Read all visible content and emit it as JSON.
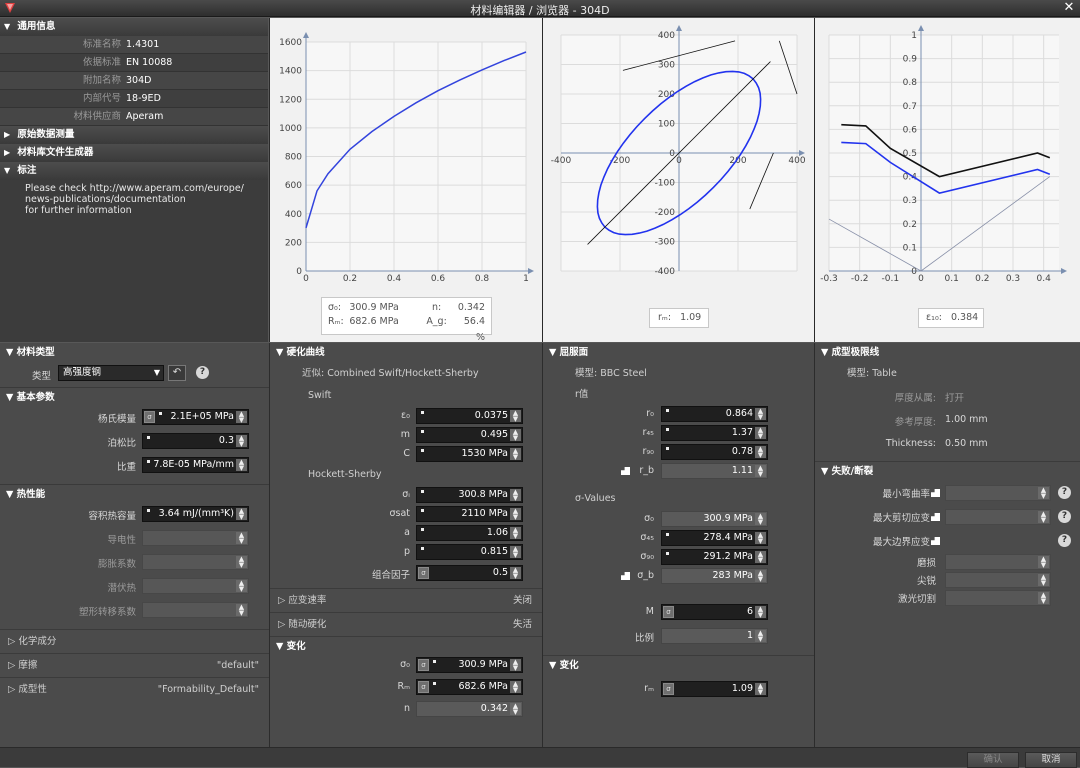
{
  "window": {
    "title": "材料编辑器 / 浏览器 - 304D",
    "close": "✕"
  },
  "general_info": {
    "header": "通用信息",
    "rows": [
      {
        "label": "标准名称",
        "value": "1.4301"
      },
      {
        "label": "依据标准",
        "value": "EN 10088"
      },
      {
        "label": "附加名称",
        "value": "304D"
      },
      {
        "label": "内部代号",
        "value": "18-9ED"
      },
      {
        "label": "材料供应商",
        "value": "Aperam"
      }
    ],
    "raw_data": "原始数据测量",
    "library_gen": "材料库文件生成器",
    "notes_header": "标注",
    "notes_lines": [
      "Please check http://www.aperam.com/europe/",
      "news-publications/documentation",
      "for further information"
    ]
  },
  "charts": {
    "hardening": {
      "x_ticks": [
        "0",
        "0.2",
        "0.4",
        "0.6",
        "0.8",
        "1"
      ],
      "y_ticks": [
        "0",
        "200",
        "400",
        "600",
        "800",
        "1000",
        "1200",
        "1400",
        "1600"
      ],
      "series_color": "#3344dd",
      "box": {
        "s0_label": "σ₀:",
        "s0": "300.9 MPa",
        "n_label": "n:",
        "n": "0.342",
        "rm_label": "Rₘ:",
        "rm": "682.6 MPa",
        "ag_label": "A_g:",
        "ag": "56.4 %"
      }
    },
    "yield": {
      "x_ticks": [
        "-400",
        "-200",
        "0",
        "200",
        "400"
      ],
      "y_ticks": [
        "-400",
        "-300",
        "-200",
        "-100",
        "0",
        "100",
        "200",
        "300",
        "400"
      ],
      "box": {
        "rm_label": "rₘ:",
        "rm": "1.09"
      }
    },
    "flc": {
      "x_ticks": [
        "-0.3",
        "-0.2",
        "-0.1",
        "0",
        "0.1",
        "0.2",
        "0.3",
        "0.4"
      ],
      "y_ticks": [
        "0",
        "0.1",
        "0.2",
        "0.3",
        "0.4",
        "0.5",
        "0.6",
        "0.7",
        "0.8",
        "0.9",
        "1"
      ],
      "box": {
        "e_label": "ε₁₀:",
        "e": "0.384"
      }
    }
  },
  "chart_data": [
    {
      "type": "line",
      "series": [
        {
          "values_x": [
            0,
            0.05,
            0.1,
            0.2,
            0.3,
            0.4,
            0.5,
            0.6,
            0.7,
            0.8,
            0.9,
            1.0
          ],
          "values_y": [
            301,
            560,
            680,
            850,
            975,
            1080,
            1175,
            1260,
            1335,
            1405,
            1470,
            1530
          ]
        }
      ],
      "xlim": [
        0,
        1
      ],
      "ylim": [
        0,
        1600
      ]
    },
    {
      "type": "line",
      "xlim": [
        -400,
        400
      ],
      "ylim": [
        -400,
        400
      ]
    },
    {
      "type": "line",
      "series": [
        {
          "x": [
            -0.26,
            -0.18,
            -0.1,
            0.06,
            0.38,
            0.42
          ],
          "y": [
            0.62,
            0.615,
            0.52,
            0.4,
            0.5,
            0.48
          ]
        },
        {
          "x": [
            -0.26,
            -0.18,
            -0.1,
            0.06,
            0.38,
            0.42
          ],
          "y": [
            0.545,
            0.54,
            0.46,
            0.33,
            0.43,
            0.41
          ]
        }
      ],
      "xlim": [
        -0.3,
        0.4
      ],
      "ylim": [
        0,
        1
      ]
    }
  ],
  "material_type": {
    "header": "材料类型",
    "type_label": "类型",
    "type_value": "高强度钢"
  },
  "basic_params": {
    "header": "基本参数",
    "rows": [
      {
        "label": "杨氏模量",
        "value": "2.1E+05 MPa"
      },
      {
        "label": "泊松比",
        "value": "0.3"
      },
      {
        "label": "比重",
        "value": "7.8E-05 MPa/mm"
      }
    ]
  },
  "thermal": {
    "header": "热性能",
    "rows": [
      {
        "label": "容积热容量",
        "value": "3.64 mJ/(mm³K)"
      },
      {
        "label": "导电性",
        "value": ""
      },
      {
        "label": "膨胀系数",
        "value": ""
      },
      {
        "label": "潜伏热",
        "value": ""
      },
      {
        "label": "塑形转移系数",
        "value": ""
      }
    ]
  },
  "left_collapsed": [
    {
      "label": "化学成分",
      "value": ""
    },
    {
      "label": "摩擦",
      "value": "\"default\""
    },
    {
      "label": "成型性",
      "value": "\"Formability_Default\""
    }
  ],
  "hardening": {
    "header": "硬化曲线",
    "approx": "近似: Combined Swift/Hockett-Sherby",
    "swift": "Swift",
    "swift_rows": [
      {
        "label": "ε₀",
        "value": "0.0375"
      },
      {
        "label": "m",
        "value": "0.495"
      },
      {
        "label": "C",
        "value": "1530 MPa"
      }
    ],
    "hs": "Hockett-Sherby",
    "hs_rows": [
      {
        "label": "σᵢ",
        "value": "300.8 MPa"
      },
      {
        "label": "σsat",
        "value": "2110 MPa"
      },
      {
        "label": "a",
        "value": "1.06"
      },
      {
        "label": "p",
        "value": "0.815"
      }
    ],
    "combine_label": "组合因子",
    "combine_value": "0.5",
    "strain_rate": "应变速率",
    "strain_rate_val": "关闭",
    "kin_hard": "随动硬化",
    "kin_hard_val": "失活",
    "change": "变化",
    "change_rows": [
      {
        "label": "σ₀",
        "value": "300.9 MPa"
      },
      {
        "label": "Rₘ",
        "value": "682.6 MPa"
      },
      {
        "label": "n",
        "value": "0.342"
      }
    ]
  },
  "yield_surface": {
    "header": "屈服面",
    "model": "模型: BBC Steel",
    "r_header": "r值",
    "r_rows": [
      {
        "label": "r₀",
        "value": "0.864"
      },
      {
        "label": "r₄₅",
        "value": "1.37"
      },
      {
        "label": "r₉₀",
        "value": "0.78"
      },
      {
        "label": "r_b",
        "value": "1.11"
      }
    ],
    "s_header": "σ-Values",
    "s_rows": [
      {
        "label": "σ₀",
        "value": "300.9 MPa"
      },
      {
        "label": "σ₄₅",
        "value": "278.4 MPa"
      },
      {
        "label": "σ₉₀",
        "value": "291.2 MPa"
      },
      {
        "label": "σ_b",
        "value": "283 MPa"
      }
    ],
    "m_label": "M",
    "m_value": "6",
    "ratio_label": "比例",
    "ratio_value": "1",
    "change": "变化",
    "rm_label": "rₘ",
    "rm_value": "1.09"
  },
  "flc_panel": {
    "header": "成型极限线",
    "model": "模型: Table",
    "thick_dep": "厚度从属:",
    "thick_dep_val": "打开",
    "ref_thick": "参考厚度:",
    "ref_thick_val": "1.00 mm",
    "thickness": "Thickness:",
    "thickness_val": "0.50 mm",
    "fail_header": "失败/断裂",
    "fail_rows": [
      "最小弯曲率",
      "最大剪切应变",
      "最大边界应变"
    ],
    "sub_rows": [
      "磨损",
      "尖锐",
      "激光切割"
    ]
  },
  "buttons": {
    "ok": "确认",
    "cancel": "取消"
  }
}
